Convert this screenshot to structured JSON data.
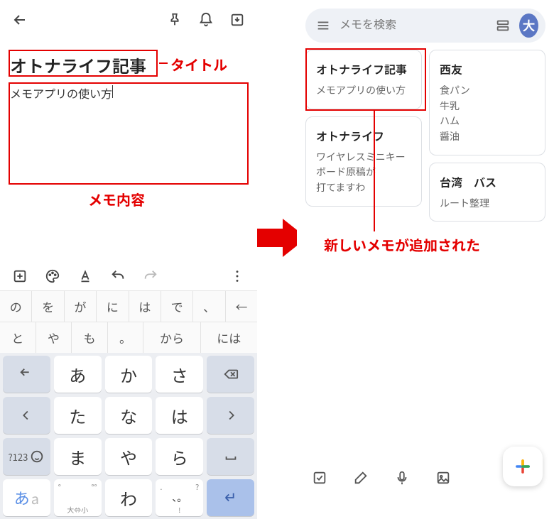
{
  "left": {
    "title": "オトナライフ記事",
    "body": "メモアプリの使い方",
    "anno_title": "タイトル",
    "anno_body": "メモ内容",
    "suggest_row1": [
      "の",
      "を",
      "が",
      "に",
      "は",
      "で",
      "、",
      "←"
    ],
    "suggest_row2": [
      "と",
      "や",
      "も",
      "。",
      "から",
      "には"
    ],
    "keys": {
      "r1": [
        "あ",
        "か",
        "さ"
      ],
      "r2": [
        "た",
        "な",
        "は"
      ],
      "r3": [
        "ま",
        "や",
        "ら"
      ],
      "r4_center": [
        "  ",
        "わ",
        "、。?!"
      ],
      "small_label": "大⇔小",
      "qtxt_label": "?123",
      "mode_ja": "あ",
      "mode_en": "a"
    }
  },
  "right": {
    "search_placeholder": "メモを検索",
    "avatar": "大",
    "cards_left": [
      {
        "title": "オトナライフ記事",
        "sub": "メモアプリの使い方"
      },
      {
        "title": "オトナライフ",
        "sub": "ワイヤレスミニキーボード原稿が\n打てますわ"
      }
    ],
    "cards_right": [
      {
        "title": "西友",
        "sub": "食パン\n牛乳\nハム\n醤油"
      },
      {
        "title": "台湾　バス",
        "sub": "ルート整理"
      }
    ],
    "anno_added": "新しいメモが追加された"
  }
}
